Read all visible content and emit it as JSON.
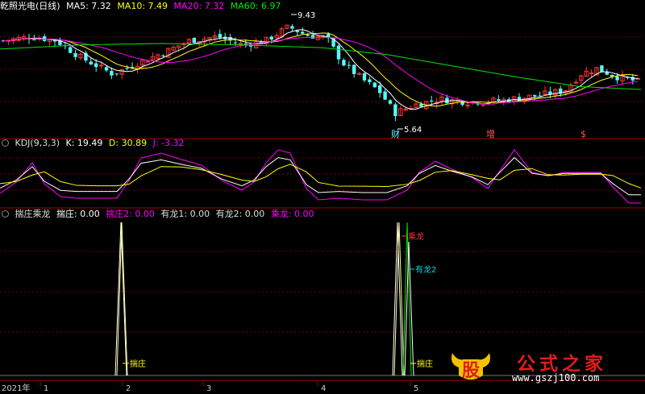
{
  "main_panel": {
    "title": "乾照光电(日线)",
    "ma5": "MA5: 7.32",
    "ma10": "MA10: 7.49",
    "ma20": "MA20: 7.32",
    "ma60": "MA60: 6.97",
    "high_label": "9.43",
    "low_label": "5.64",
    "markers": [
      "财",
      "增",
      "$"
    ]
  },
  "kdj_panel": {
    "name": "KDJ(9,3,3)",
    "k": "K: 19.49",
    "d": "D: 30.89",
    "j": "J: -3.32"
  },
  "ind_panel": {
    "name": "揣庄乘龙",
    "v1": "揣庄: 0.00",
    "v2": "揣庄2: 0.00",
    "v3": "有龙1: 0.00",
    "v4": "有龙2: 0.00",
    "v5": "乘龙: 0.00",
    "spike_labels": {
      "zhuang": "揣庄",
      "chenglong": "乘龙",
      "youlong2": "有龙2"
    }
  },
  "time_axis": {
    "year": "2021年",
    "months": [
      "1",
      "2",
      "3",
      "4",
      "5"
    ]
  },
  "watermark": {
    "brand": "公式之家",
    "url": "www.gszj100.com",
    "logo_text": "股"
  },
  "colors": {
    "up": "#ff3232",
    "down": "#54fcfc",
    "ma5": "#ffffff",
    "ma10": "#ffff00",
    "ma20": "#ff00ff",
    "ma60": "#00e600",
    "grid": "#8b0000",
    "k": "#ffffff",
    "d": "#ffff00",
    "j": "#ff00ff"
  },
  "chart_data": [
    {
      "type": "candlestick",
      "title": "乾照光电(日线)",
      "ylim": [
        5.3,
        9.7
      ],
      "high": 9.43,
      "low": 5.64,
      "ma_latest": {
        "MA5": 7.32,
        "MA10": 7.49,
        "MA20": 7.32,
        "MA60": 6.97
      }
    },
    {
      "type": "line",
      "title": "KDJ(9,3,3)",
      "series": [
        {
          "name": "K",
          "latest": 19.49
        },
        {
          "name": "D",
          "latest": 30.89
        },
        {
          "name": "J",
          "latest": -3.32
        }
      ]
    },
    {
      "type": "line",
      "title": "揣庄乘龙",
      "series": [
        {
          "name": "揣庄",
          "latest": 0.0
        },
        {
          "name": "揣庄2",
          "latest": 0.0
        },
        {
          "name": "有龙1",
          "latest": 0.0
        },
        {
          "name": "有龙2",
          "latest": 0.0
        },
        {
          "name": "乘龙",
          "latest": 0.0
        }
      ]
    }
  ]
}
